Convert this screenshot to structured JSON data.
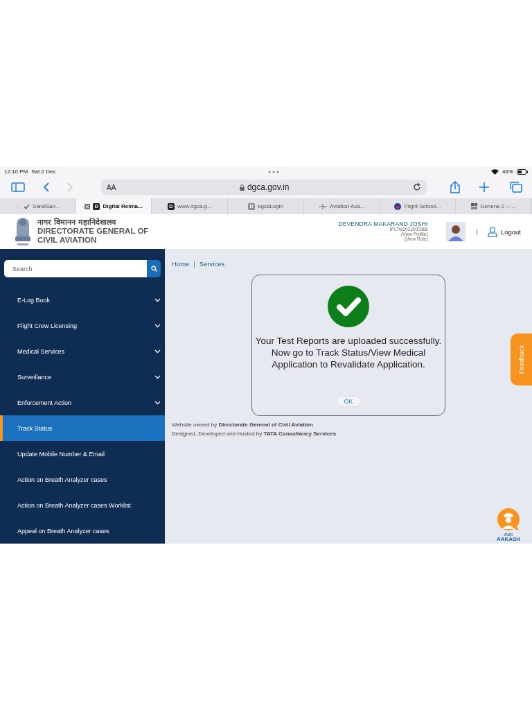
{
  "status_bar": {
    "time": "12:10 PM",
    "date": "Sat 2 Dec",
    "battery": "46%"
  },
  "browser": {
    "text_size": "AA",
    "url": "dgca.gov.in",
    "tabs": [
      {
        "label": "SaralSan...",
        "kind": "check",
        "selected": false
      },
      {
        "label": "Digital Reima...",
        "kind": "letter",
        "icon_letter": "D",
        "selected": true
      },
      {
        "label": "www.dgca.g...",
        "kind": "letter",
        "icon_letter": "D",
        "selected": false
      },
      {
        "label": "egcaLogin",
        "kind": "faint",
        "icon_letter": "D",
        "selected": false
      },
      {
        "label": "Aviation Aca...",
        "kind": "plane",
        "selected": false
      },
      {
        "label": "Flight School...",
        "kind": "globe",
        "selected": false
      },
      {
        "label": "General 2 —...",
        "kind": "grid",
        "selected": false
      }
    ]
  },
  "header": {
    "hindi_title": "नागर विमानन महानिदेशालय",
    "title_lines": [
      "DIRECTORATE GENERAL OF",
      "CIVIL AVIATION"
    ],
    "user": {
      "name": "DEVENDRA MAKARAND JOSHI",
      "id": "IPLTM2023000368",
      "links": [
        "(View Profile)",
        "(View Role)"
      ]
    },
    "separator": "|",
    "logout": "Logout"
  },
  "sidebar": {
    "search": {
      "placeholder": "Search"
    },
    "items": [
      {
        "label": "E-Log Book",
        "expandable": true,
        "selected": false
      },
      {
        "label": "Flight Crew Licensing",
        "expandable": true,
        "selected": false
      },
      {
        "label": "Medical Services",
        "expandable": true,
        "selected": false
      },
      {
        "label": "Surveillance",
        "expandable": true,
        "selected": false
      },
      {
        "label": "Enforcement Action",
        "expandable": true,
        "selected": false
      },
      {
        "label": "Track Status",
        "expandable": false,
        "selected": true
      },
      {
        "label": "Update Mobile Number & Email",
        "expandable": false,
        "selected": false
      },
      {
        "label": "Action on Breath Analyzer cases",
        "expandable": false,
        "selected": false
      },
      {
        "label": "Action on Breath Analyzer cases Worklist",
        "expandable": false,
        "selected": false
      },
      {
        "label": "Appeal on Breath Analyzer cases",
        "expandable": false,
        "selected": false
      }
    ]
  },
  "breadcrumb": {
    "items": [
      "Home",
      "Services"
    ],
    "separator": "|"
  },
  "dialog": {
    "message": "Your Test Reports are uploaded successfully. Now go to Track Status/View Medical Application to Revalidate Application.",
    "button": "OK"
  },
  "footer": [
    "Website owned by **Directorate General of Civil Aviation**",
    "Designed, Developed and Hosted by **TATA Consultancy Services**"
  ],
  "feedback": "Feedback",
  "assistant": {
    "prefix": "Ask",
    "name": "AAKASH"
  }
}
